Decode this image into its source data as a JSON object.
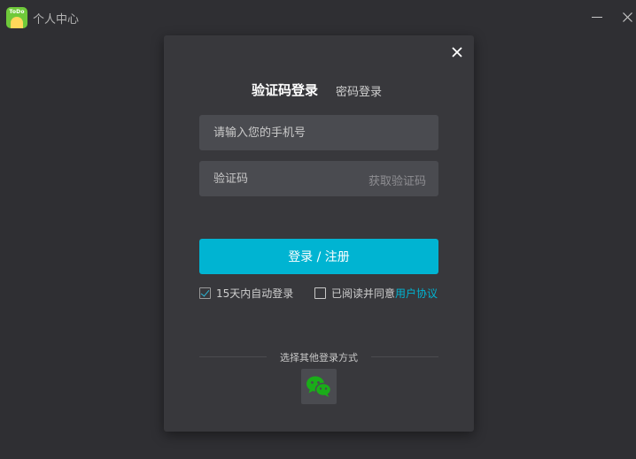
{
  "window": {
    "title": "个人中心",
    "logo_text": "ToDo",
    "icons": {
      "minimize": "minimize-icon",
      "close": "close-icon"
    }
  },
  "dialog": {
    "tabs": [
      {
        "label": "验证码登录",
        "active": true
      },
      {
        "label": "密码登录",
        "active": false
      }
    ],
    "phone_placeholder": "请输入您的手机号",
    "code_placeholder": "验证码",
    "get_code_label": "获取验证码",
    "submit_label": "登录 / 注册",
    "remember": {
      "label": "15天内自动登录",
      "checked": true
    },
    "agree": {
      "label": "已阅读并同意",
      "link": "用户协议",
      "checked": false
    },
    "other_login_label": "选择其他登录方式",
    "other_login_icon": "wechat-icon"
  },
  "colors": {
    "accent": "#00b4d2",
    "background": "#2f2f33",
    "dialog": "#38383c",
    "field": "#4a4b50",
    "wechat": "#1aad19"
  }
}
